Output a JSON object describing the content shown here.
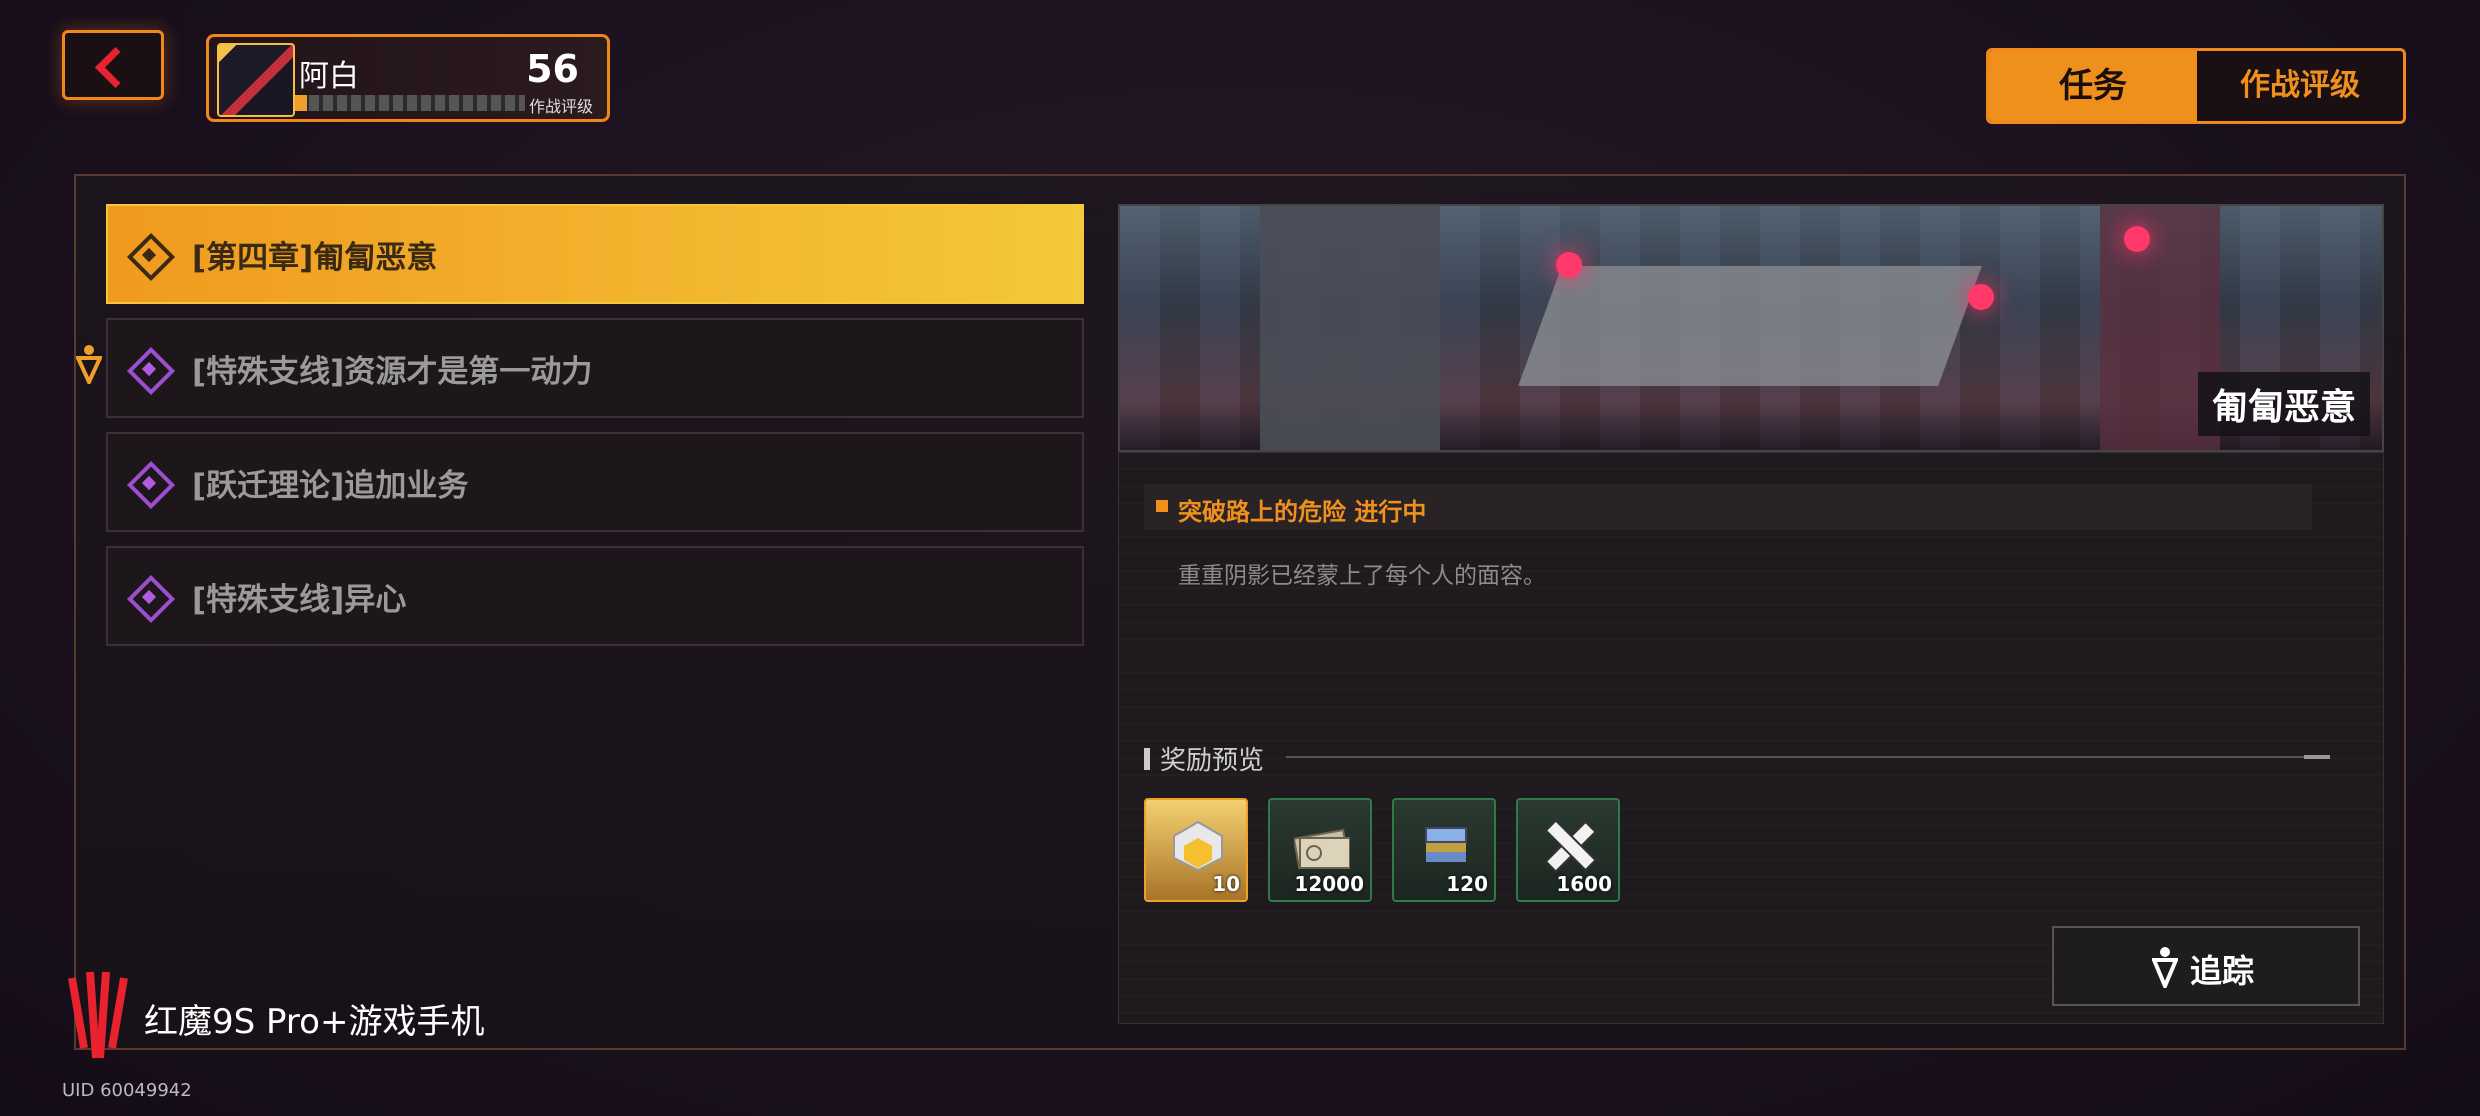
{
  "header": {
    "player": {
      "name": "阿白",
      "level": "56",
      "level_label": "作战评级",
      "xp_fraction": 0.05
    },
    "tabs": [
      {
        "label": "任务",
        "active": true
      },
      {
        "label": "作战评级",
        "active": false
      }
    ]
  },
  "missions": [
    {
      "label": "[第四章]匍匐恶意",
      "active": true,
      "icon": "main-quest-icon"
    },
    {
      "label": "[特殊支线]资源才是第一动力",
      "active": false,
      "icon": "side-quest-icon",
      "tracked": true
    },
    {
      "label": "[跃迁理论]追加业务",
      "active": false,
      "icon": "side-quest-icon"
    },
    {
      "label": "[特殊支线]异心",
      "active": false,
      "icon": "side-quest-icon"
    }
  ],
  "detail": {
    "banner_title": "匍匐恶意",
    "objective": "突破路上的危险  进行中",
    "description": "重重阴影已经蒙上了每个人的面容。",
    "rewards_title": "奖励预览",
    "rewards": [
      {
        "icon": "gold-cube-icon",
        "quantity": "10",
        "rarity": "gold"
      },
      {
        "icon": "banknote-icon",
        "quantity": "12000",
        "rarity": "green"
      },
      {
        "icon": "chip-stack-icon",
        "quantity": "120",
        "rarity": "green"
      },
      {
        "icon": "cross-material-icon",
        "quantity": "1600",
        "rarity": "green"
      }
    ],
    "track_label": "追踪"
  },
  "watermark": {
    "brand": "红魔9S Pro+游戏手机",
    "uid": "UID 60049942"
  },
  "colors": {
    "accent": "#f0901c",
    "side_quest": "#9b4fd0",
    "highlight": "#f4c83a"
  }
}
